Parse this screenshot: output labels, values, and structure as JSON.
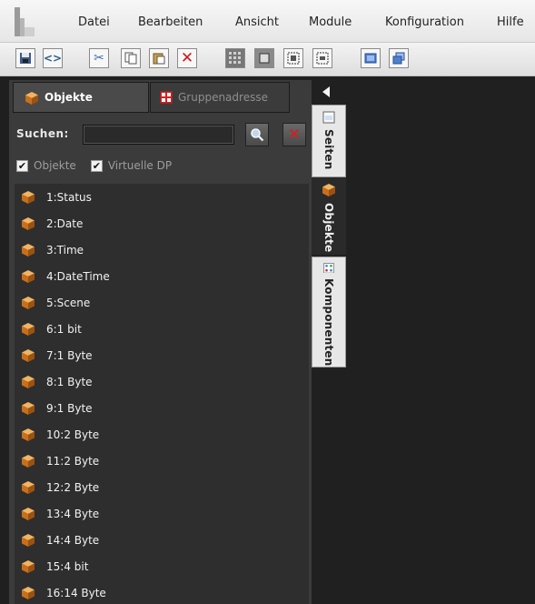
{
  "menu": {
    "items": [
      "Datei",
      "Bearbeiten",
      "Ansicht",
      "Module",
      "Konfiguration",
      "Hilfe"
    ]
  },
  "toolbar": {
    "buttons": [
      "save",
      "code",
      "cut",
      "copy",
      "paste",
      "delete",
      "grid",
      "frame",
      "bring-front",
      "send-back",
      "window",
      "window-restore"
    ]
  },
  "panel": {
    "tabs": [
      {
        "label": "Objekte",
        "active": true
      },
      {
        "label": "Gruppenadresse",
        "active": false
      }
    ],
    "search": {
      "label": "Suchen:",
      "value": ""
    },
    "checkboxes": [
      {
        "label": "Objekte",
        "checked": true
      },
      {
        "label": "Virtuelle DP",
        "checked": true
      }
    ],
    "objects": [
      "1:Status",
      "2:Date",
      "3:Time",
      "4:DateTime",
      "5:Scene",
      "6:1 bit",
      "7:1 Byte",
      "8:1 Byte",
      "9:1 Byte",
      "10:2 Byte",
      "11:2 Byte",
      "12:2 Byte",
      "13:4 Byte",
      "14:4 Byte",
      "15:4 bit",
      "16:14 Byte"
    ]
  },
  "side_tabs": [
    {
      "label": "Seiten",
      "active": true
    },
    {
      "label": "Objekte",
      "active": false
    },
    {
      "label": "Komponenten",
      "active": false
    }
  ],
  "colors": {
    "accent_orange": "#d98a2b",
    "delete_red": "#d01818",
    "panel_bg": "#3b3b3b"
  }
}
